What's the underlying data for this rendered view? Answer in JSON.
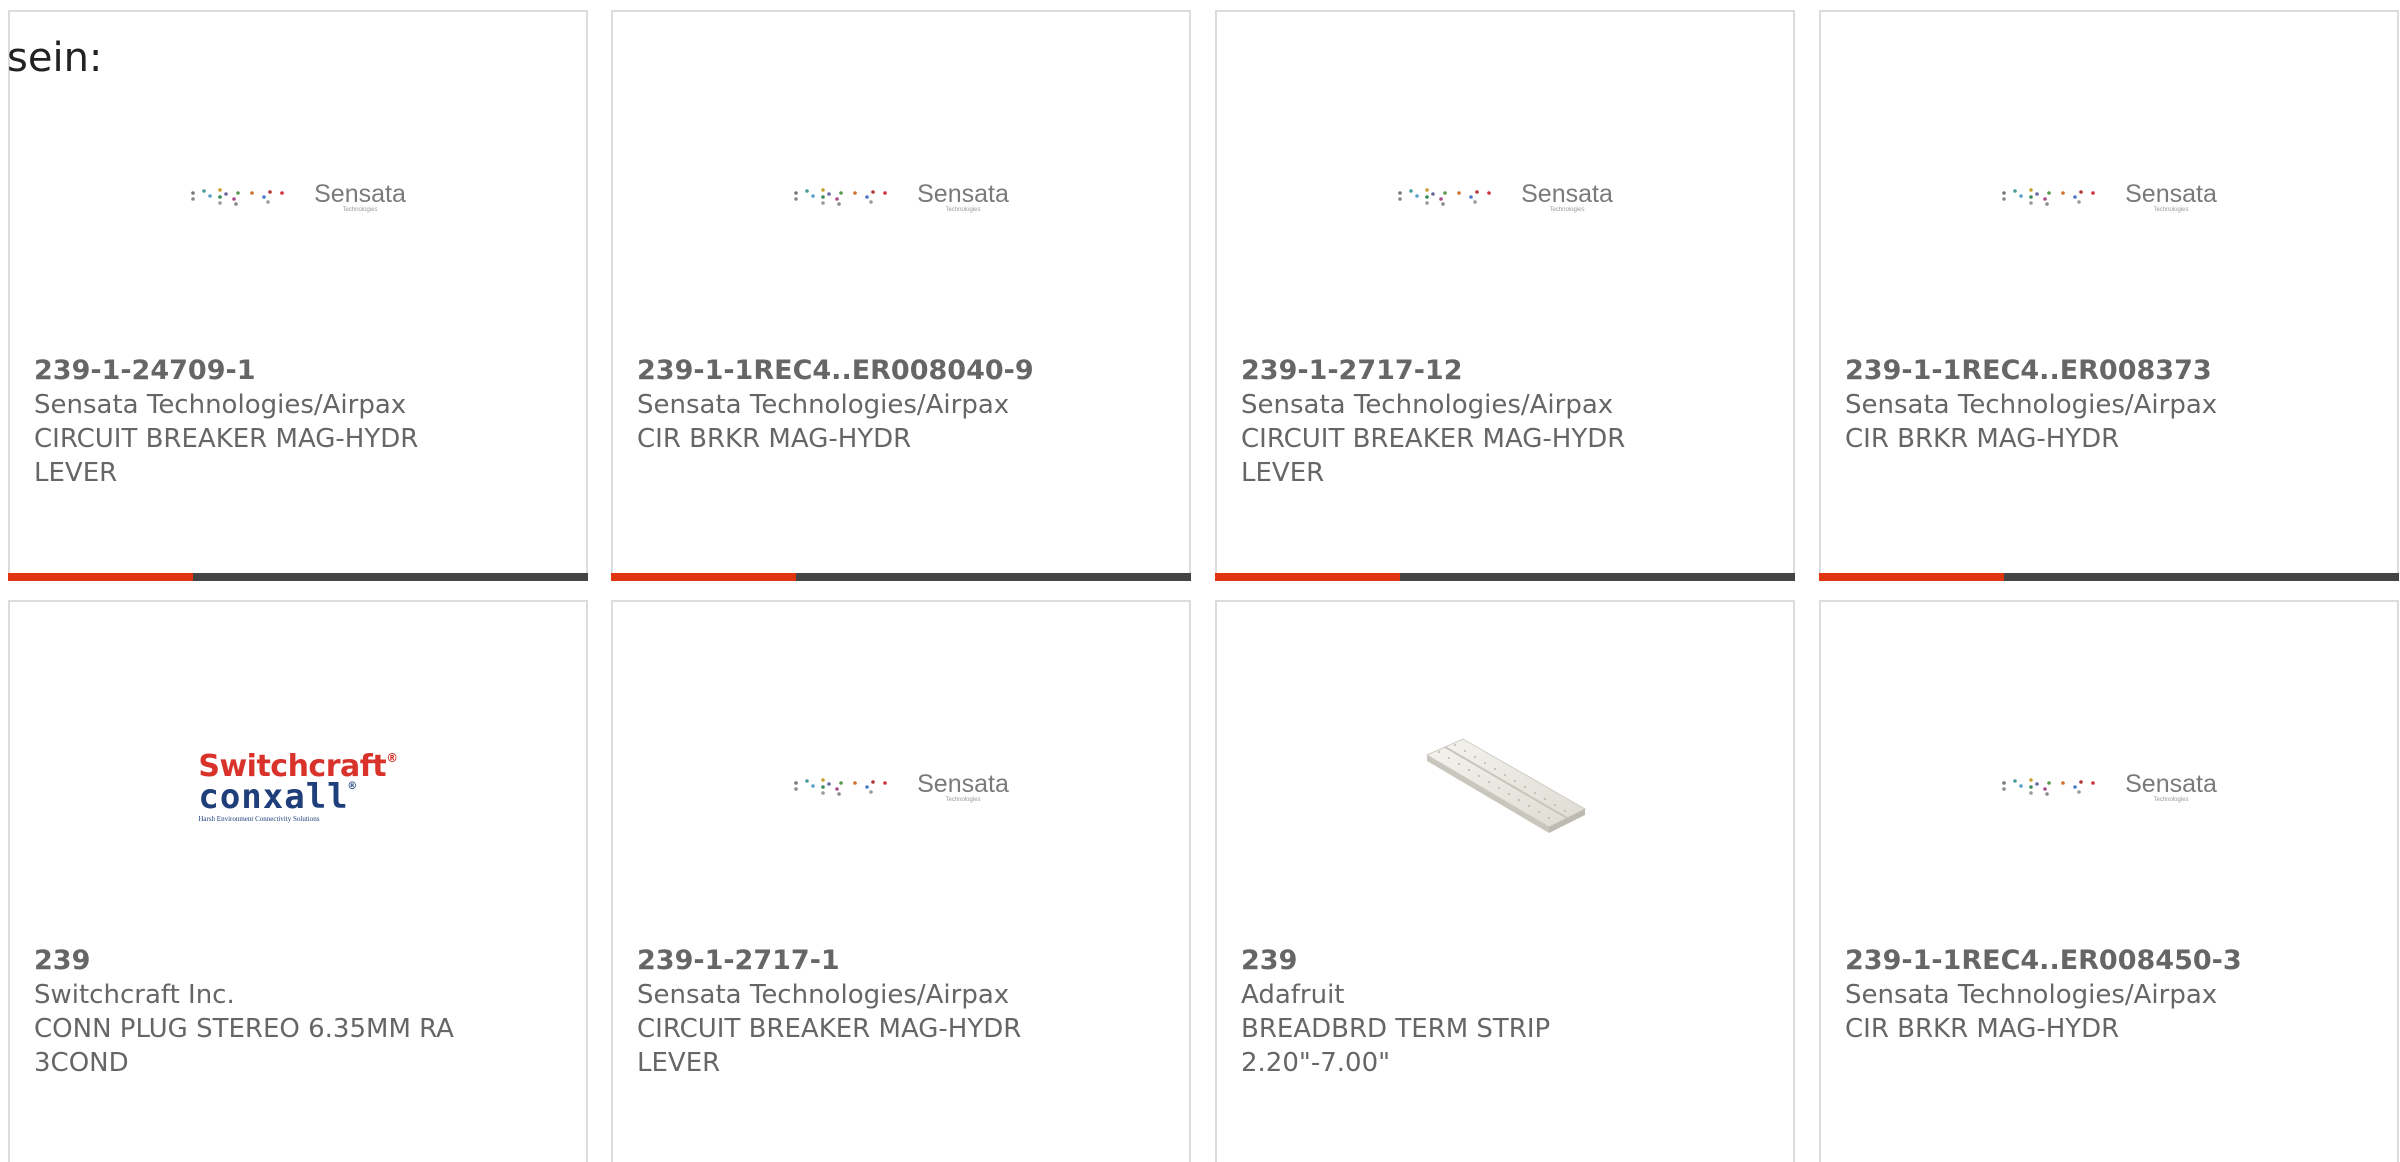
{
  "intro_text": "sein:",
  "logos": {
    "sensata": {
      "name": "Sensata",
      "sub": "Technologies"
    },
    "switchcraft": {
      "line1": "Switchcraft",
      "line2": "conxall",
      "tagline": "Harsh Environment Connectivity Solutions",
      "reg": "®"
    }
  },
  "products": [
    {
      "part": "239-1-24709-1",
      "manufacturer": "Sensata Technologies/Airpax",
      "description": "CIRCUIT BREAKER MAG-HYDR LEVER",
      "image": "sensata-logo"
    },
    {
      "part": "239-1-1REC4..ER008040-9",
      "manufacturer": "Sensata Technologies/Airpax",
      "description": "CIR BRKR MAG-HYDR",
      "image": "sensata-logo"
    },
    {
      "part": "239-1-2717-12",
      "manufacturer": "Sensata Technologies/Airpax",
      "description": "CIRCUIT BREAKER MAG-HYDR LEVER",
      "image": "sensata-logo"
    },
    {
      "part": "239-1-1REC4..ER008373",
      "manufacturer": "Sensata Technologies/Airpax",
      "description": "CIR BRKR MAG-HYDR",
      "image": "sensata-logo"
    },
    {
      "part": "239",
      "manufacturer": "Switchcraft Inc.",
      "description": "CONN PLUG STEREO 6.35MM RA 3COND",
      "image": "switchcraft-logo"
    },
    {
      "part": "239-1-2717-1",
      "manufacturer": "Sensata Technologies/Airpax",
      "description": "CIRCUIT BREAKER MAG-HYDR LEVER",
      "image": "sensata-logo"
    },
    {
      "part": "239",
      "manufacturer": "Adafruit",
      "description": "BREADBRD TERM STRIP 2.20\"-7.00\"",
      "image": "breadboard-photo"
    },
    {
      "part": "239-1-1REC4..ER008450-3",
      "manufacturer": "Sensata Technologies/Airpax",
      "description": "CIR BRKR MAG-HYDR",
      "image": "sensata-logo"
    }
  ],
  "colors": {
    "accent": "#e0350e",
    "bar": "#444444",
    "text": "#666666",
    "border": "#dcdcdc"
  }
}
